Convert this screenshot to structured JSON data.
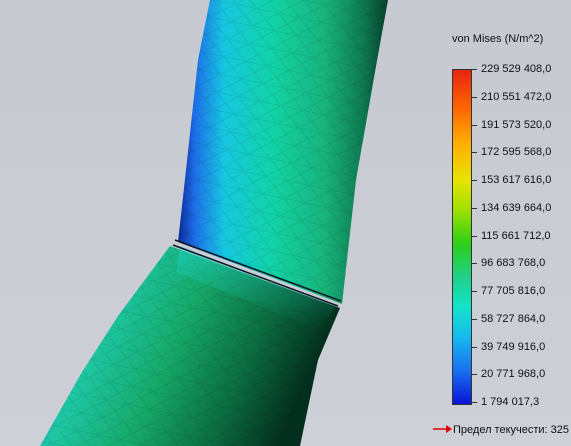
{
  "legend": {
    "title": "von Mises (N/m^2)",
    "ticks": [
      "229 529 408,0",
      "210 551 472,0",
      "191 573 520,0",
      "172 595 568,0",
      "153 617 616,0",
      "134 639 664,0",
      "115 661 712,0",
      "96 683 768,0",
      "77 705 816,0",
      "58 727 864,0",
      "39 749 916,0",
      "20 771 968,0",
      "1 794 017,3"
    ],
    "yield_label": "Предел текучести: 325",
    "colors": [
      "#e62410",
      "#ff6a00",
      "#ffae00",
      "#e7e400",
      "#9ee000",
      "#2ecf1a",
      "#1fd089",
      "#14e3c9",
      "#18b9ef",
      "#1970f0",
      "#0a14d8"
    ]
  },
  "viewport": {
    "background": "#c9ccd3",
    "model": "stress-plot-pipe-elbow"
  }
}
